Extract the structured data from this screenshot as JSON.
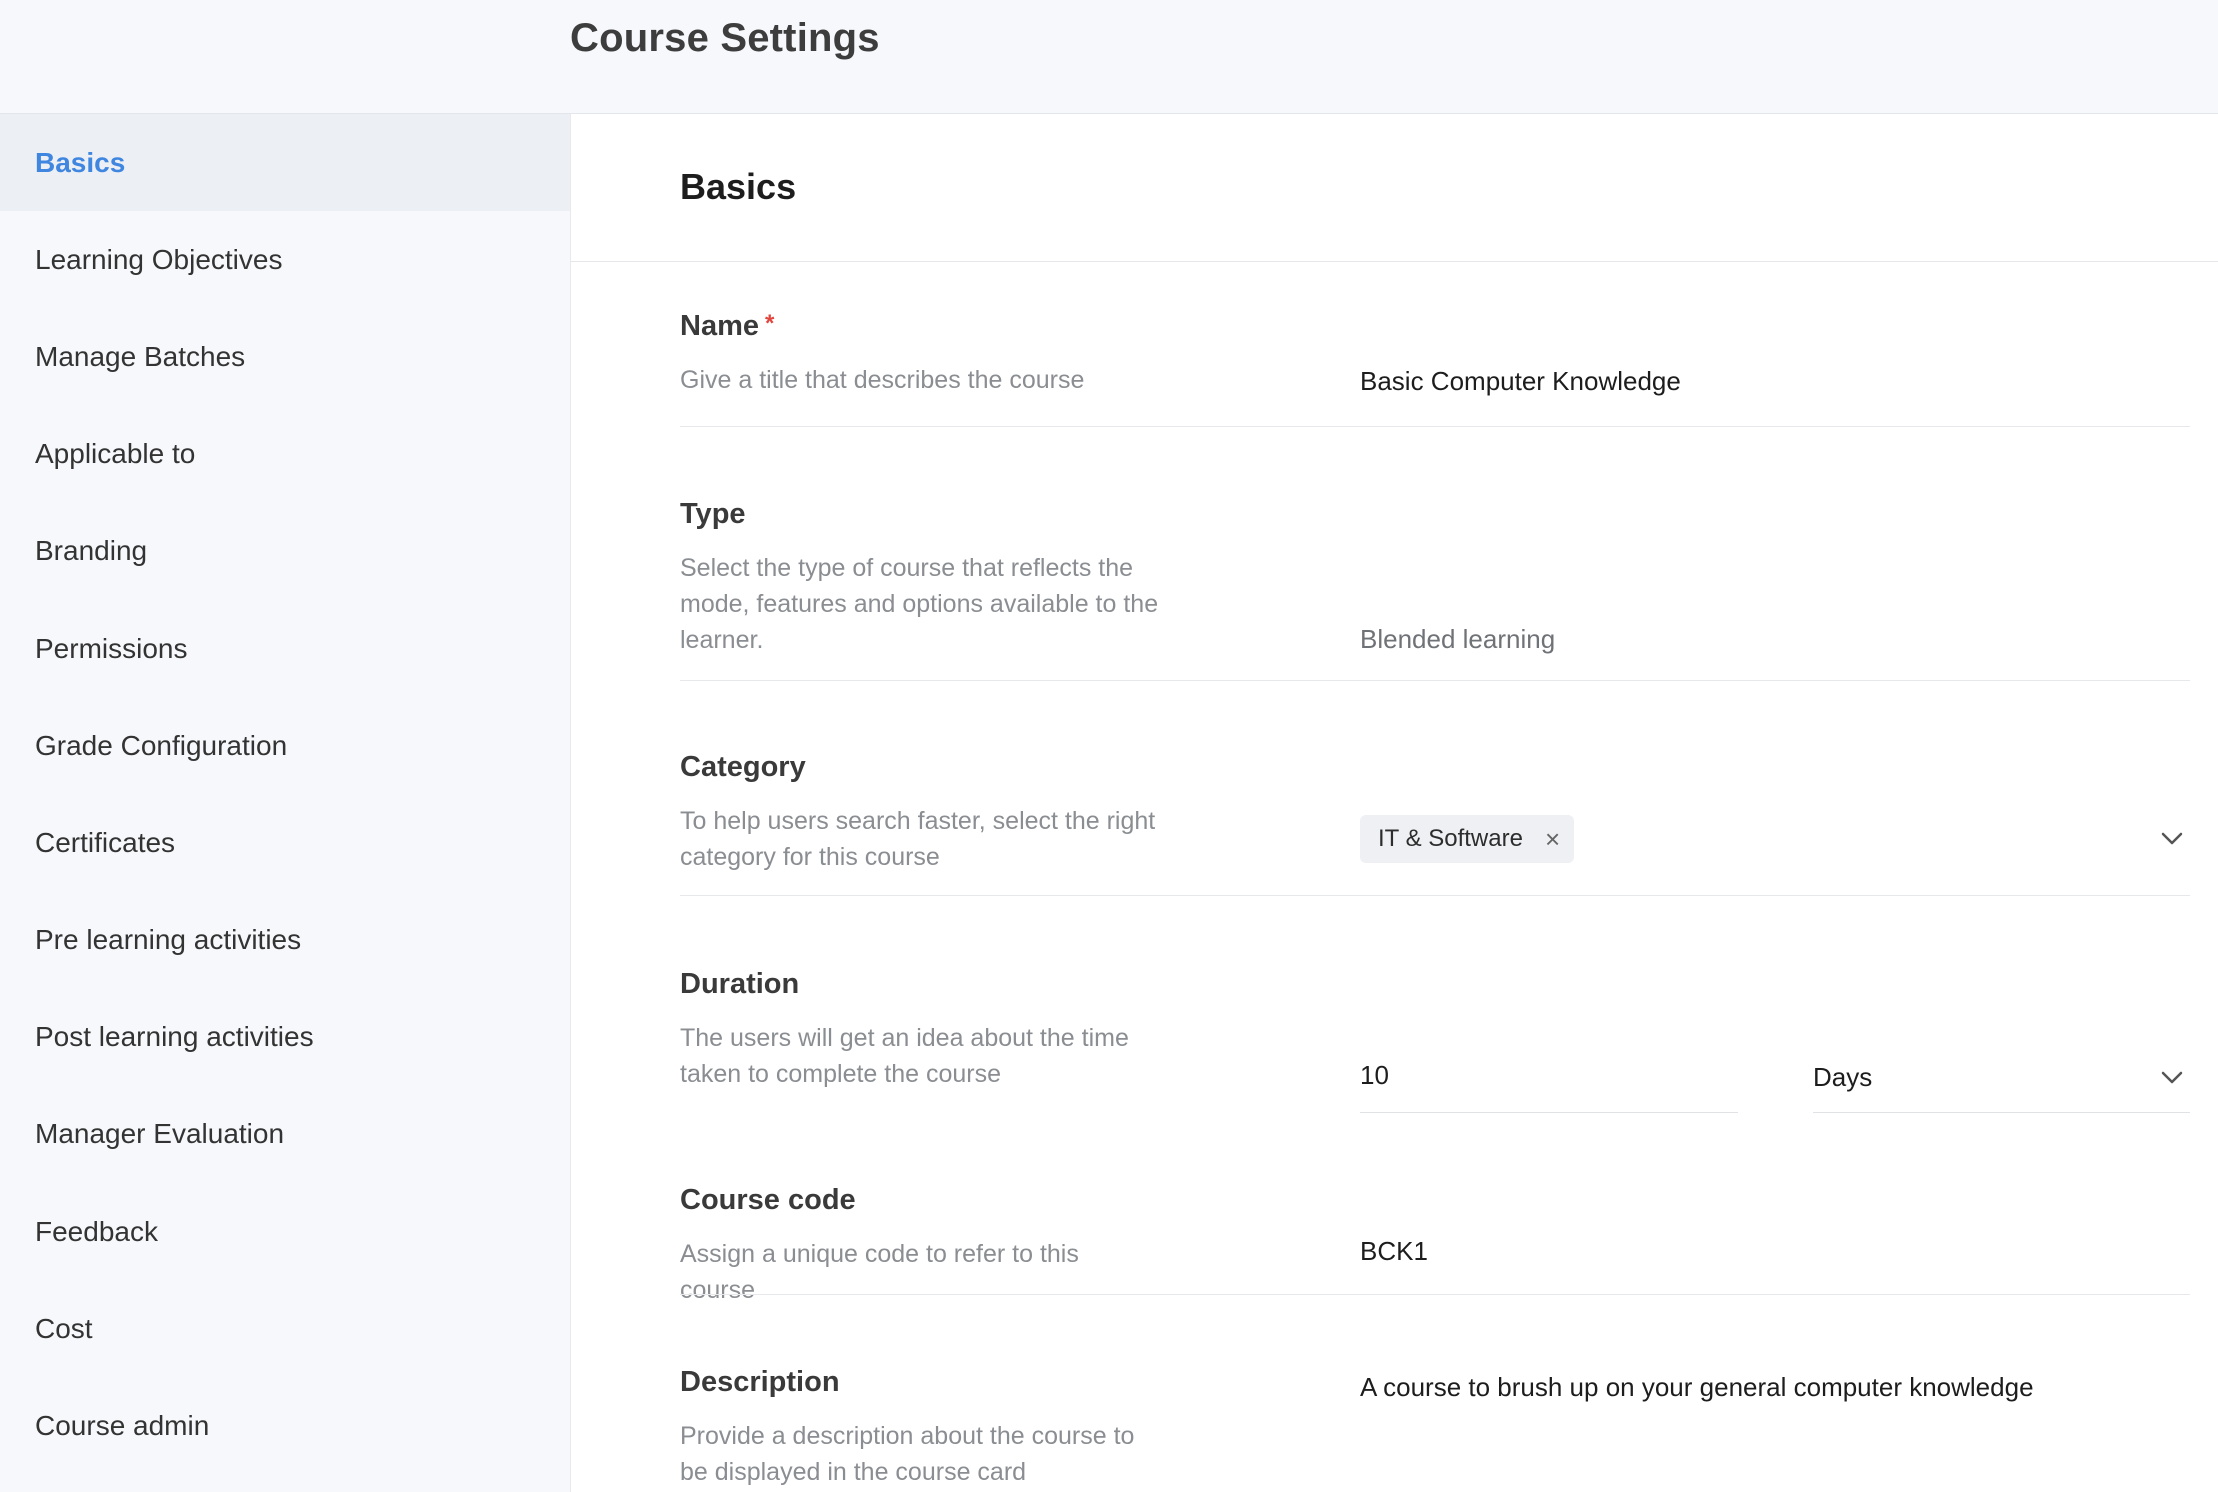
{
  "header": {
    "title": "Course Settings"
  },
  "sidebar": {
    "items": [
      {
        "label": "Basics",
        "active": true
      },
      {
        "label": "Learning Objectives"
      },
      {
        "label": "Manage Batches"
      },
      {
        "label": "Applicable to"
      },
      {
        "label": "Branding"
      },
      {
        "label": "Permissions"
      },
      {
        "label": "Grade Configuration"
      },
      {
        "label": "Certificates"
      },
      {
        "label": "Pre learning activities"
      },
      {
        "label": "Post learning activities"
      },
      {
        "label": "Manager Evaluation"
      },
      {
        "label": "Feedback"
      },
      {
        "label": "Cost"
      },
      {
        "label": "Course admin"
      }
    ]
  },
  "main": {
    "section_title": "Basics",
    "fields": {
      "name": {
        "label": "Name",
        "required_mark": "*",
        "hint": "Give a title that describes the course",
        "value": "Basic Computer Knowledge"
      },
      "type": {
        "label": "Type",
        "hint": "Select the type of course that reflects the mode, features and options available to the learner.",
        "value": "Blended learning"
      },
      "category": {
        "label": "Category",
        "hint": "To help users search faster, select the right category for this course",
        "chip": "IT & Software",
        "chip_remove": "×",
        "dropdown_icon": "chevron-down-icon"
      },
      "duration": {
        "label": "Duration",
        "hint": "The users will get an idea about the time taken to complete the course",
        "value": "10",
        "unit": "Days",
        "dropdown_icon": "chevron-down-icon"
      },
      "course_code": {
        "label": "Course code",
        "hint": "Assign a unique code to refer to this course",
        "value": "BCK1"
      },
      "description": {
        "label": "Description",
        "hint": "Provide a description about the course to be displayed in the course card",
        "value": "A course to brush up on your general computer knowledge"
      }
    }
  },
  "colors": {
    "accent": "#3f86e0",
    "required": "#e0463e"
  }
}
